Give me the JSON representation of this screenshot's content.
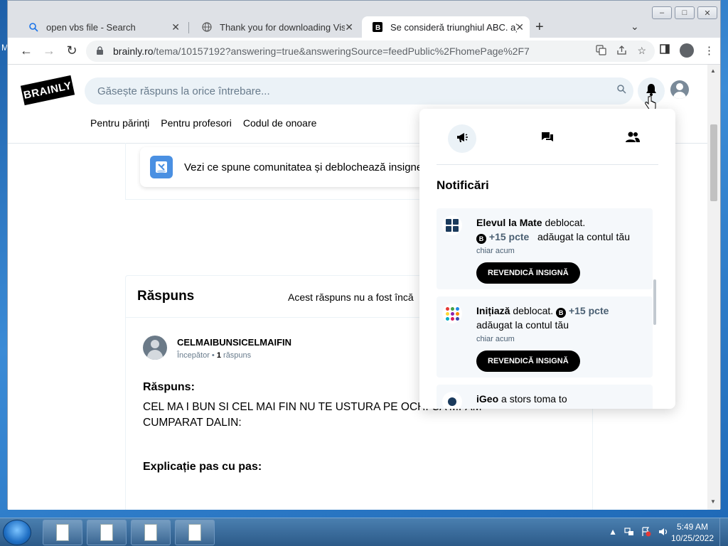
{
  "desktop": {
    "stray_letter": "M"
  },
  "window": {
    "controls": [
      "–",
      "□",
      "✕"
    ]
  },
  "tabs": [
    {
      "title": "open vbs file - Search",
      "icon": "search-icon"
    },
    {
      "title": "Thank you for downloading Visu",
      "icon": "globe-icon"
    },
    {
      "title": "Se consideră triunghiul ABC. a) S",
      "icon": "brainly-favicon-icon"
    }
  ],
  "toolbar": {
    "url_host": "brainly.ro",
    "url_path": "/tema/10157192?answering=true&answeringSource=feedPublic%2FhomePage%2F7"
  },
  "header": {
    "logo": "BRAINLY",
    "search_placeholder": "Găsește răspuns la orice întrebare...",
    "nav": [
      "Pentru părinți",
      "Pentru profesori",
      "Codul de onoare"
    ]
  },
  "community": {
    "text": "Vezi ce spune comunitatea și deblochează insigne"
  },
  "answer": {
    "heading": "Răspuns",
    "notice": "Acest răspuns nu a fost încă",
    "username": "CELMAIBUNSICELMAIFIN",
    "rank": "Începător",
    "answers_count": "1",
    "answers_word": "răspuns",
    "label_answer": "Răspuns:",
    "text": "CEL MA I BUN SI CEL MAI FIN NU TE USTURA PE OCHI CA MI-AM CUMPARAT DALIN:",
    "label_explanation": "Explicație pas cu pas:"
  },
  "notifications": {
    "title": "Notificări",
    "items": [
      {
        "badge": "Elevul la Mate",
        "status": "deblocat.",
        "points": "+15 pcte",
        "added": "adăugat la contul tău",
        "time": "chiar acum",
        "button": "REVENDICĂ INSIGNĂ"
      },
      {
        "badge": "Inițiază",
        "status": "deblocat.",
        "points": "+15 pcte",
        "added": "adăugat la contul tău",
        "time": "chiar acum",
        "button": "REVENDICĂ INSIGNĂ"
      },
      {
        "badge": "iGeo",
        "status": "a stors toma to"
      }
    ]
  },
  "taskbar": {
    "time": "5:49 AM",
    "date": "10/25/2022"
  },
  "colors": {
    "accent": "#000000",
    "search_bg": "#ebf2f7",
    "text_muted": "#687b8c"
  }
}
